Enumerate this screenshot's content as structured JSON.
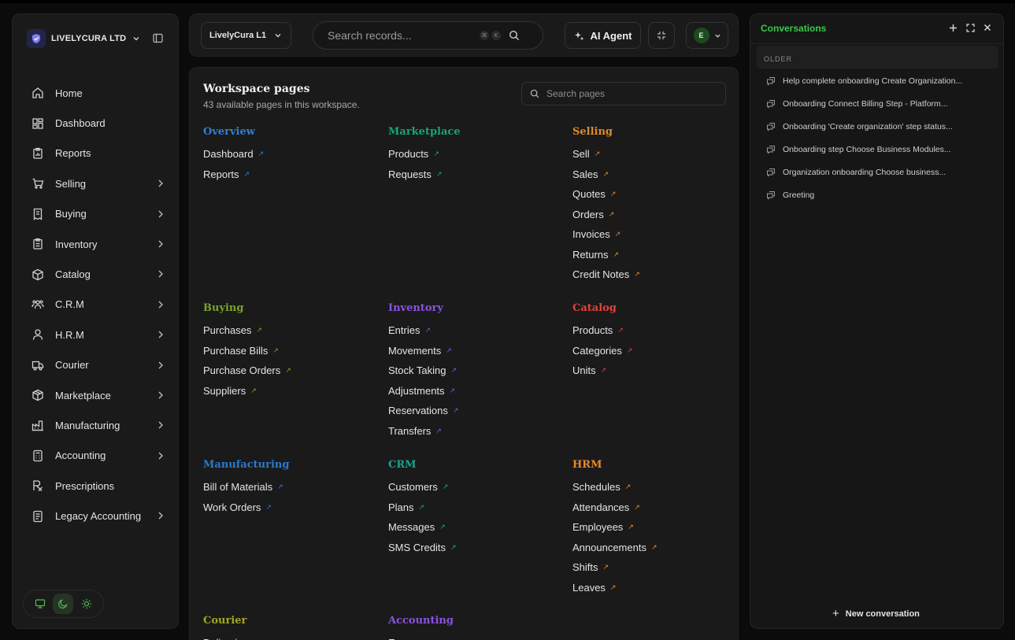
{
  "org": {
    "name": "LIVELYCURA LTD",
    "logo_icon": "shield-check-icon"
  },
  "sidebar": {
    "items": [
      {
        "label": "Home",
        "icon": "home-icon",
        "has_submenu": false
      },
      {
        "label": "Dashboard",
        "icon": "dashboard-icon",
        "has_submenu": false
      },
      {
        "label": "Reports",
        "icon": "reports-icon",
        "has_submenu": false
      },
      {
        "label": "Selling",
        "icon": "cart-icon",
        "has_submenu": true
      },
      {
        "label": "Buying",
        "icon": "receipt-icon",
        "has_submenu": true
      },
      {
        "label": "Inventory",
        "icon": "clipboard-icon",
        "has_submenu": true
      },
      {
        "label": "Catalog",
        "icon": "box-icon",
        "has_submenu": true
      },
      {
        "label": "C.R.M",
        "icon": "users-icon",
        "has_submenu": true
      },
      {
        "label": "H.R.M",
        "icon": "user-icon",
        "has_submenu": true
      },
      {
        "label": "Courier",
        "icon": "truck-icon",
        "has_submenu": true
      },
      {
        "label": "Marketplace",
        "icon": "package-icon",
        "has_submenu": true
      },
      {
        "label": "Manufacturing",
        "icon": "factory-icon",
        "has_submenu": true
      },
      {
        "label": "Accounting",
        "icon": "calculator-icon",
        "has_submenu": true
      },
      {
        "label": "Prescriptions",
        "icon": "rx-icon",
        "has_submenu": false
      },
      {
        "label": "Legacy Accounting",
        "icon": "ledger-icon",
        "has_submenu": true
      }
    ]
  },
  "topbar": {
    "location": "LivelyCura L1",
    "search_placeholder": "Search records...",
    "kbd_keys": [
      "⌘",
      "K"
    ],
    "ai_agent_label": "AI Agent",
    "avatar_initial": "E"
  },
  "workspace": {
    "title": "Workspace pages",
    "subtitle": "43 available pages in this workspace.",
    "search_placeholder": "Search pages",
    "groups": [
      {
        "title": "Overview",
        "color": "#2f7fd6",
        "links": [
          "Dashboard",
          "Reports"
        ]
      },
      {
        "title": "Marketplace",
        "color": "#18a572",
        "links": [
          "Products",
          "Requests"
        ]
      },
      {
        "title": "Selling",
        "color": "#e0892a",
        "links": [
          "Sell",
          "Sales",
          "Quotes",
          "Orders",
          "Invoices",
          "Returns",
          "Credit Notes"
        ]
      },
      {
        "title": "Buying",
        "color": "#7aa32a",
        "links": [
          "Purchases",
          "Purchase Bills",
          "Purchase Orders",
          "Suppliers"
        ]
      },
      {
        "title": "Inventory",
        "color": "#8a52e0",
        "links": [
          "Entries",
          "Movements",
          "Stock Taking",
          "Adjustments",
          "Reservations",
          "Transfers"
        ]
      },
      {
        "title": "Catalog",
        "color": "#e0433c",
        "links": [
          "Products",
          "Categories",
          "Units"
        ]
      },
      {
        "title": "Manufacturing",
        "color": "#2c79c9",
        "links": [
          "Bill of Materials",
          "Work Orders"
        ]
      },
      {
        "title": "CRM",
        "color": "#1aa38f",
        "links": [
          "Customers",
          "Plans",
          "Messages",
          "SMS Credits"
        ]
      },
      {
        "title": "HRM",
        "color": "#e8892a",
        "links": [
          "Schedules",
          "Attendances",
          "Employees",
          "Announcements",
          "Shifts",
          "Leaves"
        ]
      },
      {
        "title": "Courier",
        "color": "#a3a61e",
        "links": [
          "Deliveries"
        ]
      },
      {
        "title": "Accounting",
        "color": "#8a52e0",
        "links": [
          "Expenses"
        ]
      }
    ]
  },
  "conversations": {
    "title": "Conversations",
    "section_label": "OLDER",
    "items": [
      "Help complete onboarding Create Organization...",
      "Onboarding Connect Billing Step - Platform...",
      "Onboarding 'Create organization' step status...",
      "Onboarding step Choose Business Modules...",
      "Organization onboarding Choose business...",
      "Greeting"
    ],
    "new_label": "New conversation"
  }
}
